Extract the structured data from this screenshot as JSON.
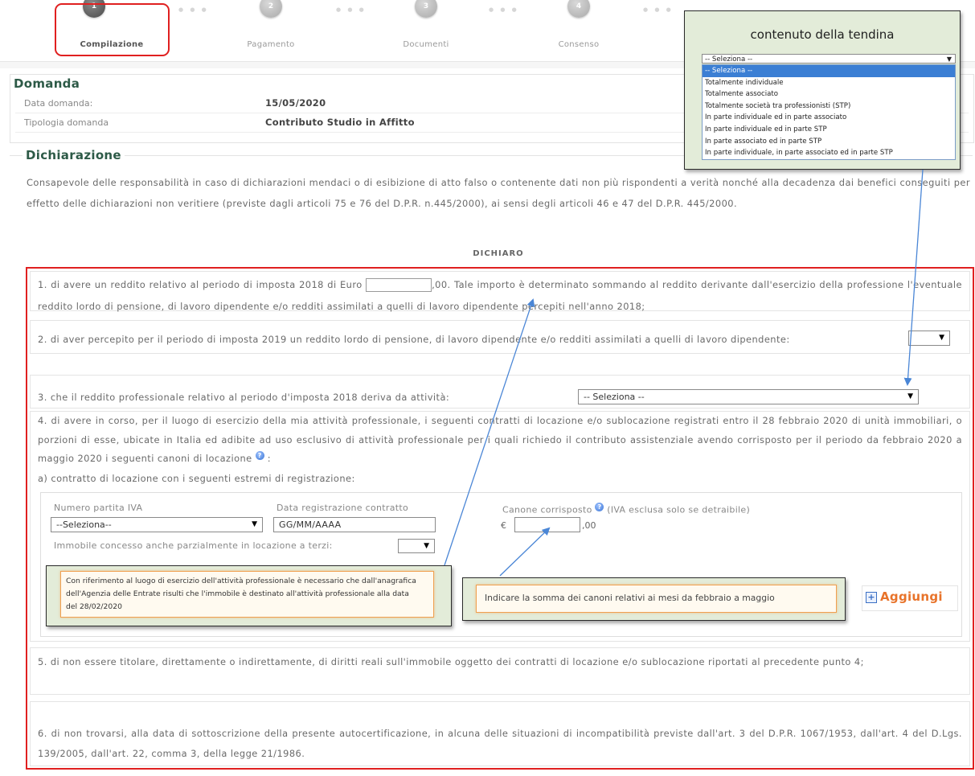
{
  "steps": [
    {
      "number": "1",
      "label": "Compilazione"
    },
    {
      "number": "2",
      "label": "Pagamento"
    },
    {
      "number": "3",
      "label": "Documenti"
    },
    {
      "number": "4",
      "label": "Consenso"
    }
  ],
  "step_separator": "● ● ●",
  "dropdown_callout": {
    "title": "contenuto della tendina",
    "selected": "-- Seleziona --",
    "arrow": "▼",
    "options": [
      "-- Seleziona --",
      "Totalmente individuale",
      "Totalmente associato",
      "Totalmente società tra professionisti (STP)",
      "In parte individuale ed in parte associato",
      "In parte individuale ed in parte STP",
      "In parte associato ed in parte STP",
      "In parte individuale, in parte associato ed in parte STP"
    ]
  },
  "domanda": {
    "title": "Domanda",
    "rows": [
      {
        "label": "Data domanda:",
        "value": "15/05/2020"
      },
      {
        "label": "Tipologia domanda",
        "value": "Contributo Studio in Affitto"
      }
    ]
  },
  "dichiarazione": {
    "title": "Dichiarazione",
    "intro": "Consapevole delle responsabilità in caso di dichiarazioni mendaci o di esibizione di atto falso o contenente dati non più rispondenti a verità nonché alla decadenza dai benefici conseguiti per effetto delle dichiarazioni non veritiere (previste dagli articoli 75 e 76 del D.P.R. n.445/2000), ai sensi degli articoli 46 e 47 del D.P.R. 445/2000.",
    "dichiaro": "DICHIARO"
  },
  "items": {
    "item1": {
      "before": "1. di avere un reddito relativo al periodo di imposta 2018 di Euro",
      "input_value": "",
      "after": ",00. Tale importo è determinato sommando al reddito derivante dall'esercizio della professione l'eventuale reddito lordo di pensione, di lavoro dipendente e/o redditi assimilati a quelli di lavoro dipendente percepiti nell'anno 2018;"
    },
    "item2": {
      "text": "2. di aver percepito per il periodo di imposta 2019 un reddito lordo di pensione, di lavoro dipendente e/o redditi assimilati a quelli di lavoro dipendente:",
      "select_value": "",
      "select_arrow": "▼"
    },
    "item3": {
      "text": "3. che il reddito professionale relativo al periodo d'imposta 2018 deriva da attività:",
      "select_value": "-- Seleziona --",
      "select_arrow": "▼"
    },
    "item4": {
      "text": "4. di avere in corso, per il luogo di esercizio della mia attività professionale, i seguenti contratti di locazione e/o sublocazione registrati entro il 28 febbraio 2020 di unità immobiliari, o porzioni di esse, ubicate in Italia ed adibite ad uso esclusivo di attività professionale per i quali richiedo il contributo assistenziale avendo corrisposto per il periodo da febbraio 2020 a maggio 2020 i seguenti canoni di locazione",
      "help": "?",
      "text_end": " :",
      "sub_a": "a) contratto di locazione con i seguenti estremi di registrazione:"
    },
    "item5": {
      "text": "5. di non essere titolare, direttamente o indirettamente, di diritti reali sull'immobile oggetto dei contratti di locazione e/o sublocazione riportati al precedente punto 4;"
    },
    "item6": {
      "text": "6. di non trovarsi, alla data di sottoscrizione della presente autocertificazione, in alcuna delle situazioni di incompatibilità previste dall'art. 3 del D.P.R. 1067/1953, dall'art. 4 del D.Lgs. 139/2005, dall'art. 22, comma 3, della legge 21/1986."
    }
  },
  "contract": {
    "partita_iva_label": "Numero partita IVA",
    "partita_iva_value": "--Seleziona--",
    "data_label": "Data registrazione contratto",
    "data_placeholder": "GG/MM/AAAA",
    "canone_label": "Canone corrisposto",
    "canone_help": "?",
    "canone_note": "(IVA esclusa solo se detraibile)",
    "currency": "€",
    "canone_value": "",
    "decimals": ",00",
    "immobile_label": "Immobile concesso anche parzialmente in locazione a terzi:",
    "immobile_value": "",
    "arrow": "▼"
  },
  "tooltips": {
    "luogo_esercizio": "Con riferimento al luogo di esercizio dell'attività professionale è necessario che dall'anagrafica dell'Agenzia delle Entrate risulti che l'immobile è destinato all'attività professionale alla data del 28/02/2020",
    "canone": "Indicare la somma dei canoni relativi ai mesi da febbraio a maggio"
  },
  "add_button": {
    "icon": "+",
    "label": "Aggiungi"
  },
  "colors": {
    "highlight_red": "#e02020",
    "section_title": "#2d5a47",
    "arrow_blue": "#4a86d6",
    "add_orange": "#e8732a",
    "dropdown_selected": "#3b7fd4"
  }
}
